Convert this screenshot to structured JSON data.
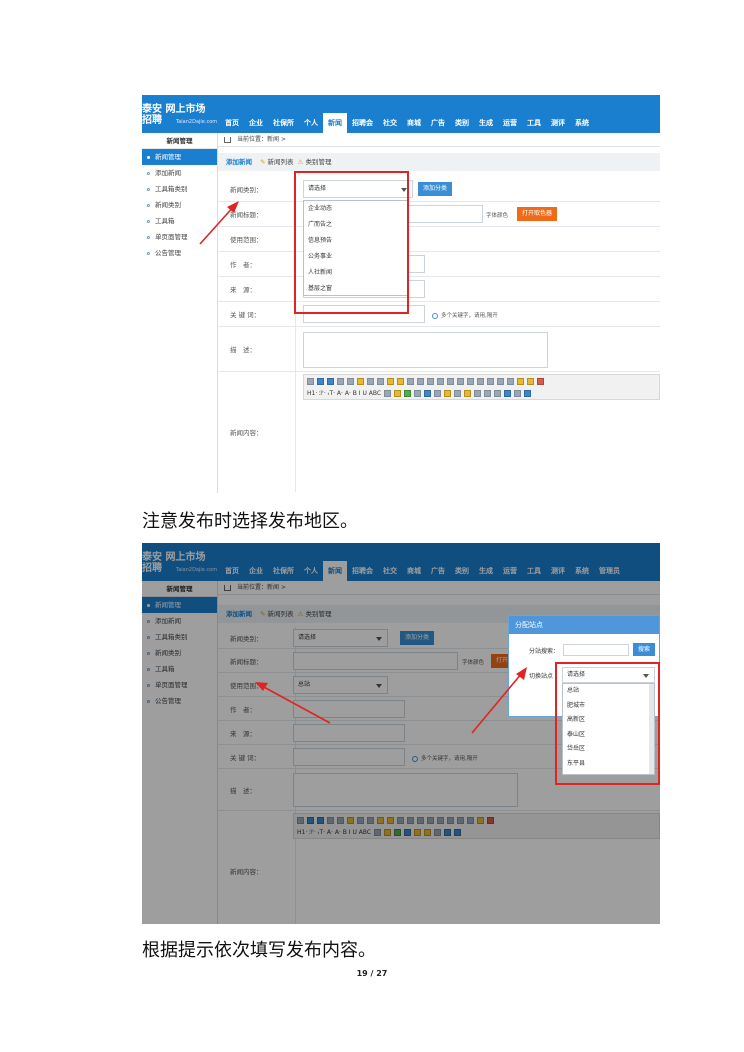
{
  "app": {
    "logo_line1": "泰安 网上市场",
    "logo_line2": "招聘",
    "logo_sub": "Taian2Dajie.com",
    "nav": [
      "首页",
      "企业",
      "社保所",
      "个人",
      "新闻",
      "招聘会",
      "社交",
      "商城",
      "广告",
      "类别",
      "生成",
      "运营",
      "工具",
      "测评",
      "系统"
    ],
    "nav2_extra": "管理员",
    "active_nav": "新闻",
    "sidebar_head": "新闻管理",
    "sidebar": [
      "新闻管理",
      "添加新闻",
      "工具箱类别",
      "新闻类别",
      "工具箱",
      "单页面管理",
      "公告管理"
    ],
    "crumb": "当前位置：新闻 >",
    "tabs": {
      "add": "添加新闻",
      "list": "新闻列表",
      "cat": "类别管理"
    },
    "form": {
      "category": "新闻类别：",
      "title": "新闻标题：",
      "scope": "使用范围：",
      "author": "作　者：",
      "source": "来　源：",
      "keywords": "关 键 词：",
      "desc": "描　述：",
      "content": "新闻内容："
    },
    "select_placeholder": "请选择",
    "add_category_btn": "添加分类",
    "font_color": "字体颜色",
    "open_picker_btn": "打开取色器",
    "open_picker_short": "打开",
    "keywords_hint": "多个关键字，请用,隔开",
    "scope_value": "总站",
    "toolbar_row1": "",
    "toolbar_row2_prefix": "H1·  ℱ·  ₜT·  A·  A·  B  I  U  ABC"
  },
  "shot1": {
    "category_options": [
      "企业动态",
      "广而告之",
      "信息预告",
      "公务事业",
      "人社新闻",
      "基层之窗"
    ]
  },
  "shot2": {
    "dialog_title": "分配站点",
    "search_label": "分站搜索：",
    "search_btn": "搜索",
    "switch_label": "切换站点",
    "select_placeholder": "请选择",
    "site_options": [
      "总站",
      "肥城市",
      "高新区",
      "泰山区",
      "岱岳区",
      "东平县"
    ]
  },
  "captions": {
    "c1": "注意发布时选择发布地区。",
    "c2": "根据提示依次填写发布内容。"
  },
  "page_number": "19 / 27",
  "colors": {
    "brand_blue": "#1b7fcf",
    "highlight_red": "#e02323",
    "orange": "#ef6b1a"
  }
}
